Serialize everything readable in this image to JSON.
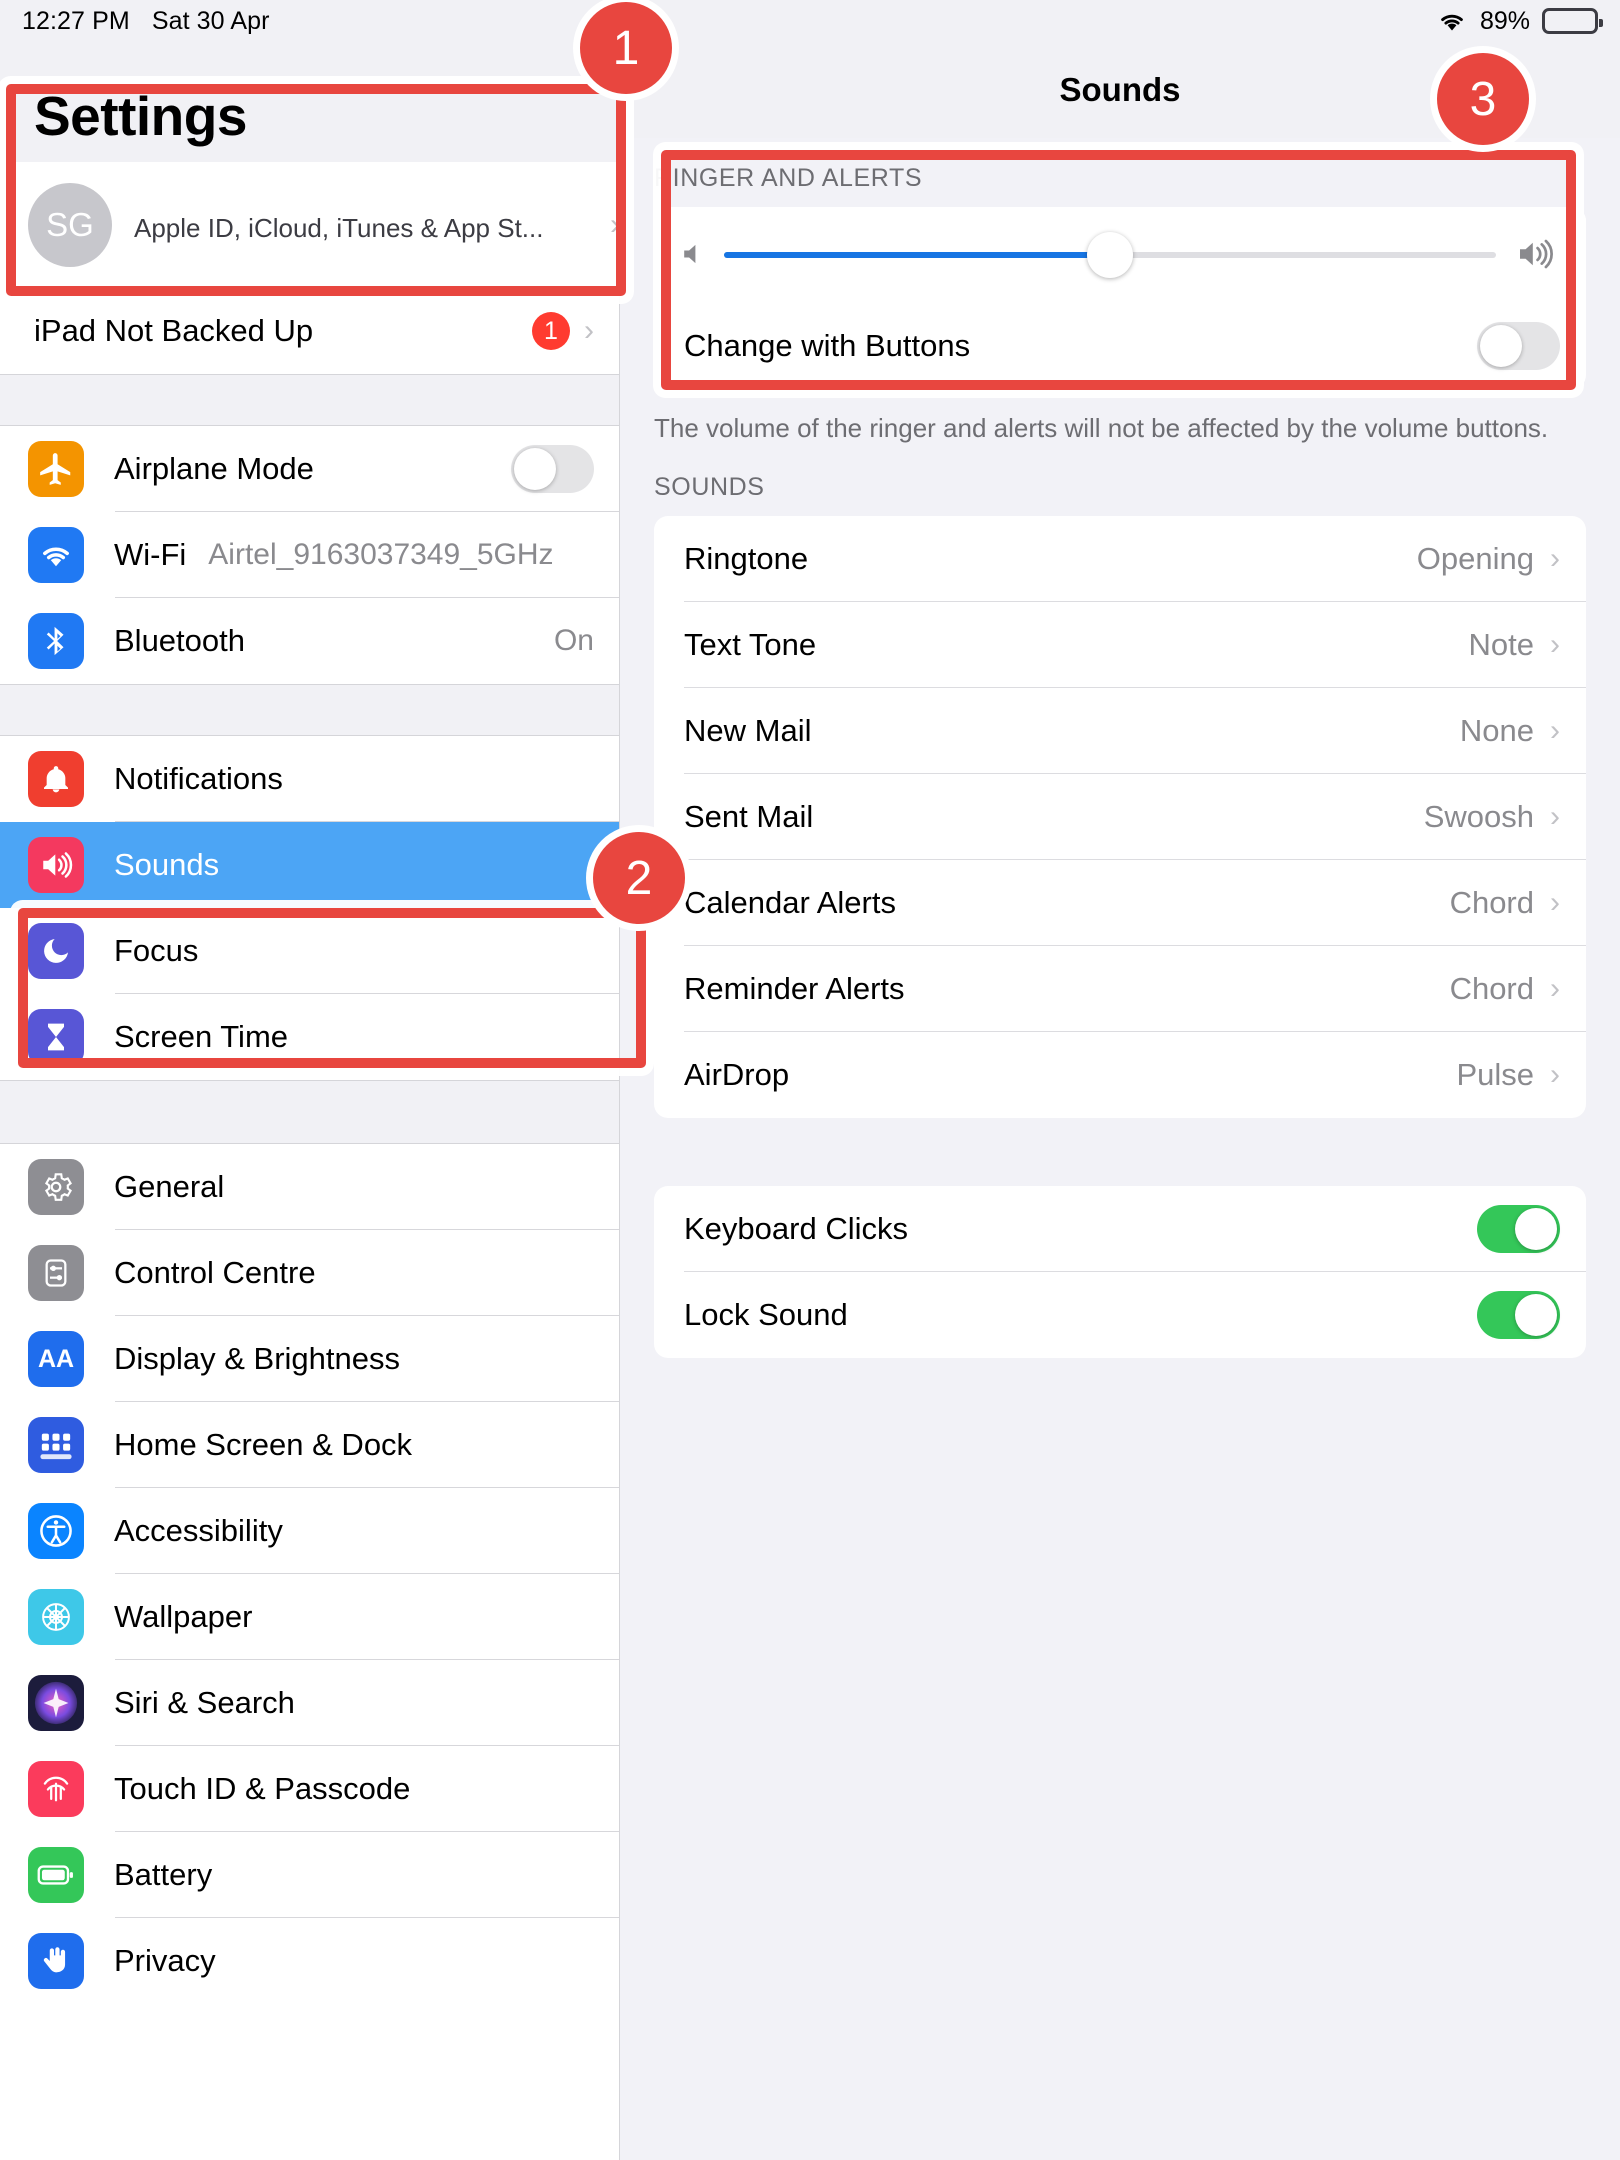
{
  "statusbar": {
    "time": "12:27 PM",
    "date": "Sat 30 Apr",
    "battery_percent": "89%",
    "wifi_icon": "wifi-icon",
    "battery_icon": "battery-icon"
  },
  "sidebar": {
    "title": "Settings",
    "account": {
      "avatar_initials": "SG",
      "name": "",
      "subtitle": "Apple ID, iCloud, iTunes & App St...",
      "chevron": "›"
    },
    "backup_row": {
      "label": "iPad Not Backed Up",
      "badge": "1",
      "chevron": "›"
    },
    "connectivity": [
      {
        "label": "Airplane Mode",
        "icon": "airplane-icon",
        "icon_color": "#f49400",
        "control": "toggle",
        "value": "",
        "toggle_on": false
      },
      {
        "label": "Wi-Fi",
        "icon": "wifi-icon",
        "icon_color": "#2079f3",
        "control": "value",
        "value": "Airtel_9163037349_5GHz",
        "toggle_on": false
      },
      {
        "label": "Bluetooth",
        "icon": "bluetooth-icon",
        "icon_color": "#2079f3",
        "control": "value",
        "value": "On",
        "toggle_on": false
      }
    ],
    "notifications_group": [
      {
        "label": "Notifications",
        "icon": "notifications-icon",
        "icon_color": "#f03e2f",
        "selected": false
      },
      {
        "label": "Sounds",
        "icon": "sounds-icon",
        "icon_color": "#f4395f",
        "selected": true
      },
      {
        "label": "Focus",
        "icon": "focus-icon",
        "icon_color": "#5856d6",
        "selected": false
      },
      {
        "label": "Screen Time",
        "icon": "screen-time-icon",
        "icon_color": "#5856d6",
        "selected": false
      }
    ],
    "general_group": [
      {
        "label": "General",
        "icon": "gear-icon",
        "icon_color": "#8e8e93"
      },
      {
        "label": "Control Centre",
        "icon": "control-centre-icon",
        "icon_color": "#8e8e93"
      },
      {
        "label": "Display & Brightness",
        "icon": "display-brightness-icon",
        "icon_color": "#1f6ded"
      },
      {
        "label": "Home Screen & Dock",
        "icon": "home-screen-dock-icon",
        "icon_color": "#2f5ce0"
      },
      {
        "label": "Accessibility",
        "icon": "accessibility-icon",
        "icon_color": "#0a84ff"
      },
      {
        "label": "Wallpaper",
        "icon": "wallpaper-icon",
        "icon_color": "#3ec8e8"
      },
      {
        "label": "Siri & Search",
        "icon": "siri-search-icon",
        "icon_color": "#1c1c3c"
      },
      {
        "label": "Touch ID & Passcode",
        "icon": "touch-id-icon",
        "icon_color": "#fb3b5c"
      },
      {
        "label": "Battery",
        "icon": "battery-icon",
        "icon_color": "#34c759"
      },
      {
        "label": "Privacy",
        "icon": "privacy-icon",
        "icon_color": "#1f6ded"
      }
    ]
  },
  "detail": {
    "title": "Sounds",
    "ringer_section_header": "RINGER AND ALERTS",
    "volume_slider": {
      "value_percent": 50,
      "min_icon": "speaker-low-icon",
      "max_icon": "speaker-high-icon",
      "fill_color": "#1775e3"
    },
    "change_with_buttons": {
      "label": "Change with Buttons",
      "toggle_on": false
    },
    "footnote": "The volume of the ringer and alerts will not be affected by the volume buttons.",
    "sounds_section_header": "SOUNDS",
    "sounds_rows": [
      {
        "label": "Ringtone",
        "value": "Opening",
        "chevron": "›"
      },
      {
        "label": "Text Tone",
        "value": "Note",
        "chevron": "›"
      },
      {
        "label": "New Mail",
        "value": "None",
        "chevron": "›"
      },
      {
        "label": "Sent Mail",
        "value": "Swoosh",
        "chevron": "›"
      },
      {
        "label": "Calendar Alerts",
        "value": "Chord",
        "chevron": "›"
      },
      {
        "label": "Reminder Alerts",
        "value": "Chord",
        "chevron": "›"
      },
      {
        "label": "AirDrop",
        "value": "Pulse",
        "chevron": "›"
      }
    ],
    "toggle_rows": [
      {
        "label": "Keyboard Clicks",
        "toggle_on": true
      },
      {
        "label": "Lock Sound",
        "toggle_on": true
      }
    ]
  },
  "annotations": {
    "color": "#e8463f",
    "markers": [
      {
        "number": "1",
        "target": "settings-title"
      },
      {
        "number": "2",
        "target": "sidebar-item-sounds"
      },
      {
        "number": "3",
        "target": "ringer-and-alerts-section"
      }
    ]
  }
}
